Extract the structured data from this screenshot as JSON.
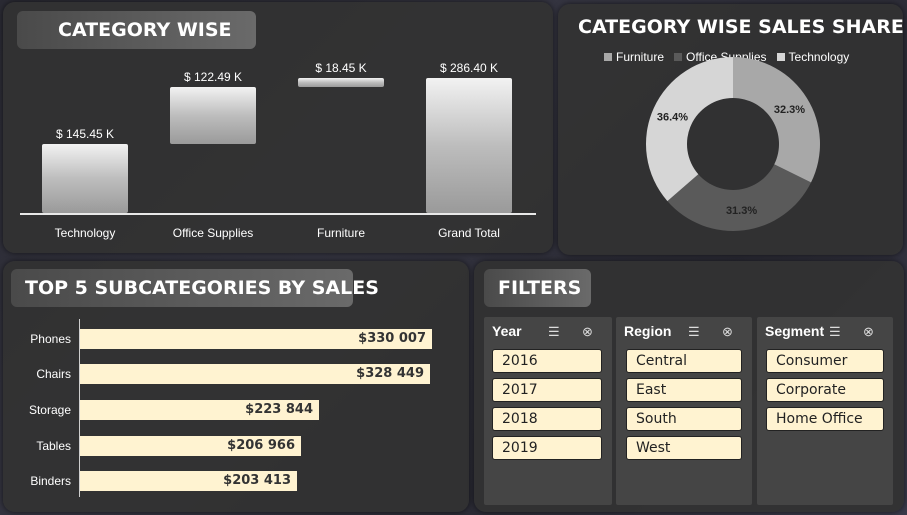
{
  "category_panel": {
    "title": "CATEGORY WISE",
    "bars": [
      {
        "label": "$ 145.45  K",
        "category": "Technology"
      },
      {
        "label": "$ 122.49  K",
        "category": "Office Supplies"
      },
      {
        "label": "$ 18.45  K",
        "category": "Furniture"
      },
      {
        "label": "$ 286.40  K",
        "category": "Grand Total"
      }
    ]
  },
  "share_panel": {
    "title": "CATEGORY WISE SALES SHARE %",
    "legend": [
      "Furniture",
      "Office Supplies",
      "Technology"
    ],
    "slice_labels": [
      "32.3%",
      "31.3%",
      "36.4%"
    ]
  },
  "top5_panel": {
    "title": "TOP 5 SUBCATEGORIES BY SALES",
    "rows": [
      {
        "category": "Phones",
        "label": "$330 007"
      },
      {
        "category": "Chairs",
        "label": "$328 449"
      },
      {
        "category": "Storage",
        "label": "$223 844"
      },
      {
        "category": "Tables",
        "label": "$206 966"
      },
      {
        "category": "Binders",
        "label": "$203 413"
      }
    ]
  },
  "filters_panel": {
    "title": "FILTERS",
    "slicers": [
      {
        "header": "Year",
        "items": [
          "2016",
          "2017",
          "2018",
          "2019"
        ]
      },
      {
        "header": "Region",
        "items": [
          "Central",
          "East",
          "South",
          "West"
        ]
      },
      {
        "header": "Segment",
        "items": [
          "Consumer",
          "Corporate",
          "Home Office"
        ]
      }
    ]
  },
  "chart_data": [
    {
      "type": "bar",
      "title": "CATEGORY WISE",
      "categories": [
        "Technology",
        "Office Supplies",
        "Furniture",
        "Grand Total"
      ],
      "values": [
        145.45,
        122.49,
        18.45,
        286.4
      ],
      "waterfall": true,
      "unit": "K",
      "xlabel": "",
      "ylabel": "",
      "ylim": [
        0,
        290
      ]
    },
    {
      "type": "pie",
      "title": "CATEGORY WISE SALES SHARE %",
      "categories": [
        "Furniture",
        "Office Supplies",
        "Technology"
      ],
      "values": [
        32.3,
        31.3,
        36.4
      ],
      "colors": [
        "#a8a8a8",
        "#5a5a5a",
        "#d6d6d6"
      ],
      "donut": true,
      "legend": "top"
    },
    {
      "type": "bar",
      "orientation": "horizontal",
      "title": "TOP 5 SUBCATEGORIES BY SALES",
      "categories": [
        "Phones",
        "Chairs",
        "Storage",
        "Tables",
        "Binders"
      ],
      "values": [
        330007,
        328449,
        223844,
        206966,
        203413
      ],
      "color": "#fff3d1",
      "xlabel": "",
      "ylabel": ""
    }
  ]
}
